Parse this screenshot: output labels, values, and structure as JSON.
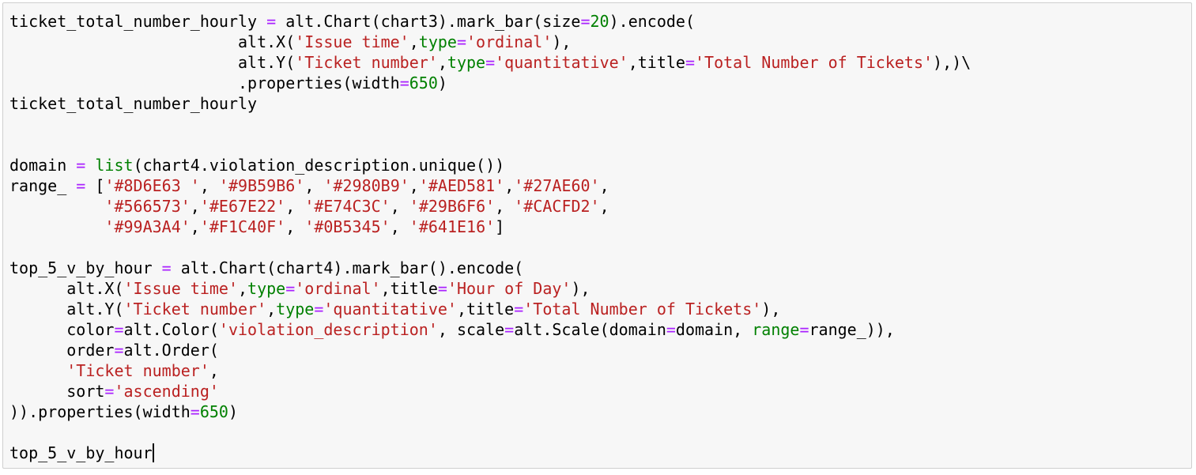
{
  "cell": {
    "lines": [
      [
        {
          "text": "ticket_total_number_hourly ",
          "kind": "default"
        },
        {
          "text": "=",
          "kind": "operator"
        },
        {
          "text": " alt.Chart(chart3).mark_bar(size",
          "kind": "default"
        },
        {
          "text": "=",
          "kind": "operator"
        },
        {
          "text": "20",
          "kind": "number"
        },
        {
          "text": ").encode(",
          "kind": "default"
        }
      ],
      [
        {
          "text": "                        alt.X(",
          "kind": "default"
        },
        {
          "text": "'Issue time'",
          "kind": "string"
        },
        {
          "text": ",",
          "kind": "default"
        },
        {
          "text": "type",
          "kind": "kwarg"
        },
        {
          "text": "=",
          "kind": "operator"
        },
        {
          "text": "'ordinal'",
          "kind": "string"
        },
        {
          "text": "),",
          "kind": "default"
        }
      ],
      [
        {
          "text": "                        alt.Y(",
          "kind": "default"
        },
        {
          "text": "'Ticket number'",
          "kind": "string"
        },
        {
          "text": ",",
          "kind": "default"
        },
        {
          "text": "type",
          "kind": "kwarg"
        },
        {
          "text": "=",
          "kind": "operator"
        },
        {
          "text": "'quantitative'",
          "kind": "string"
        },
        {
          "text": ",title",
          "kind": "default"
        },
        {
          "text": "=",
          "kind": "operator"
        },
        {
          "text": "'Total Number of Tickets'",
          "kind": "string"
        },
        {
          "text": "),)\\",
          "kind": "default"
        }
      ],
      [
        {
          "text": "                        .properties(width",
          "kind": "default"
        },
        {
          "text": "=",
          "kind": "operator"
        },
        {
          "text": "650",
          "kind": "number"
        },
        {
          "text": ")",
          "kind": "default"
        }
      ],
      [
        {
          "text": "ticket_total_number_hourly",
          "kind": "default"
        }
      ],
      [],
      [],
      [
        {
          "text": "domain ",
          "kind": "default"
        },
        {
          "text": "=",
          "kind": "operator"
        },
        {
          "text": " ",
          "kind": "default"
        },
        {
          "text": "list",
          "kind": "builtin"
        },
        {
          "text": "(chart4.violation_description.unique())",
          "kind": "default"
        }
      ],
      [
        {
          "text": "range_ ",
          "kind": "default"
        },
        {
          "text": "=",
          "kind": "operator"
        },
        {
          "text": " [",
          "kind": "default"
        },
        {
          "text": "'#8D6E63 '",
          "kind": "string"
        },
        {
          "text": ", ",
          "kind": "default"
        },
        {
          "text": "'#9B59B6'",
          "kind": "string"
        },
        {
          "text": ", ",
          "kind": "default"
        },
        {
          "text": "'#2980B9'",
          "kind": "string"
        },
        {
          "text": ",",
          "kind": "default"
        },
        {
          "text": "'#AED581'",
          "kind": "string"
        },
        {
          "text": ",",
          "kind": "default"
        },
        {
          "text": "'#27AE60'",
          "kind": "string"
        },
        {
          "text": ",",
          "kind": "default"
        }
      ],
      [
        {
          "text": "          ",
          "kind": "default"
        },
        {
          "text": "'#566573'",
          "kind": "string"
        },
        {
          "text": ",",
          "kind": "default"
        },
        {
          "text": "'#E67E22'",
          "kind": "string"
        },
        {
          "text": ", ",
          "kind": "default"
        },
        {
          "text": "'#E74C3C'",
          "kind": "string"
        },
        {
          "text": ", ",
          "kind": "default"
        },
        {
          "text": "'#29B6F6'",
          "kind": "string"
        },
        {
          "text": ", ",
          "kind": "default"
        },
        {
          "text": "'#CACFD2'",
          "kind": "string"
        },
        {
          "text": ",",
          "kind": "default"
        }
      ],
      [
        {
          "text": "          ",
          "kind": "default"
        },
        {
          "text": "'#99A3A4'",
          "kind": "string"
        },
        {
          "text": ",",
          "kind": "default"
        },
        {
          "text": "'#F1C40F'",
          "kind": "string"
        },
        {
          "text": ", ",
          "kind": "default"
        },
        {
          "text": "'#0B5345'",
          "kind": "string"
        },
        {
          "text": ", ",
          "kind": "default"
        },
        {
          "text": "'#641E16'",
          "kind": "string"
        },
        {
          "text": "]",
          "kind": "default"
        }
      ],
      [],
      [
        {
          "text": "top_5_v_by_hour ",
          "kind": "default"
        },
        {
          "text": "=",
          "kind": "operator"
        },
        {
          "text": " alt.Chart(chart4).mark_bar().encode(",
          "kind": "default"
        }
      ],
      [
        {
          "text": "      alt.X(",
          "kind": "default"
        },
        {
          "text": "'Issue time'",
          "kind": "string"
        },
        {
          "text": ",",
          "kind": "default"
        },
        {
          "text": "type",
          "kind": "kwarg"
        },
        {
          "text": "=",
          "kind": "operator"
        },
        {
          "text": "'ordinal'",
          "kind": "string"
        },
        {
          "text": ",title",
          "kind": "default"
        },
        {
          "text": "=",
          "kind": "operator"
        },
        {
          "text": "'Hour of Day'",
          "kind": "string"
        },
        {
          "text": "),",
          "kind": "default"
        }
      ],
      [
        {
          "text": "      alt.Y(",
          "kind": "default"
        },
        {
          "text": "'Ticket number'",
          "kind": "string"
        },
        {
          "text": ",",
          "kind": "default"
        },
        {
          "text": "type",
          "kind": "kwarg"
        },
        {
          "text": "=",
          "kind": "operator"
        },
        {
          "text": "'quantitative'",
          "kind": "string"
        },
        {
          "text": ",title",
          "kind": "default"
        },
        {
          "text": "=",
          "kind": "operator"
        },
        {
          "text": "'Total Number of Tickets'",
          "kind": "string"
        },
        {
          "text": "),",
          "kind": "default"
        }
      ],
      [
        {
          "text": "      color",
          "kind": "default"
        },
        {
          "text": "=",
          "kind": "operator"
        },
        {
          "text": "alt.Color(",
          "kind": "default"
        },
        {
          "text": "'violation_description'",
          "kind": "string"
        },
        {
          "text": ", scale",
          "kind": "default"
        },
        {
          "text": "=",
          "kind": "operator"
        },
        {
          "text": "alt.Scale(domain",
          "kind": "default"
        },
        {
          "text": "=",
          "kind": "operator"
        },
        {
          "text": "domain, ",
          "kind": "default"
        },
        {
          "text": "range",
          "kind": "builtin"
        },
        {
          "text": "=",
          "kind": "operator"
        },
        {
          "text": "range_)),",
          "kind": "default"
        }
      ],
      [
        {
          "text": "      order",
          "kind": "default"
        },
        {
          "text": "=",
          "kind": "operator"
        },
        {
          "text": "alt.Order(",
          "kind": "default"
        }
      ],
      [
        {
          "text": "      ",
          "kind": "default"
        },
        {
          "text": "'Ticket number'",
          "kind": "string"
        },
        {
          "text": ",",
          "kind": "default"
        }
      ],
      [
        {
          "text": "      sort",
          "kind": "default"
        },
        {
          "text": "=",
          "kind": "operator"
        },
        {
          "text": "'ascending'",
          "kind": "string"
        }
      ],
      [
        {
          "text": ")).properties(width",
          "kind": "default"
        },
        {
          "text": "=",
          "kind": "operator"
        },
        {
          "text": "650",
          "kind": "number"
        },
        {
          "text": ")",
          "kind": "default"
        }
      ],
      [],
      [
        {
          "text": "top_5_v_by_hour",
          "kind": "default"
        }
      ]
    ],
    "cursor_line_index": 21
  },
  "colors": {
    "cell_background": "#f7f7f7",
    "cell_border": "#cfcfcf",
    "string": "#ba2121",
    "number": "#008000",
    "operator": "#aa22ff",
    "builtin": "#008000",
    "kwarg": "#008000",
    "default": "#000000"
  }
}
